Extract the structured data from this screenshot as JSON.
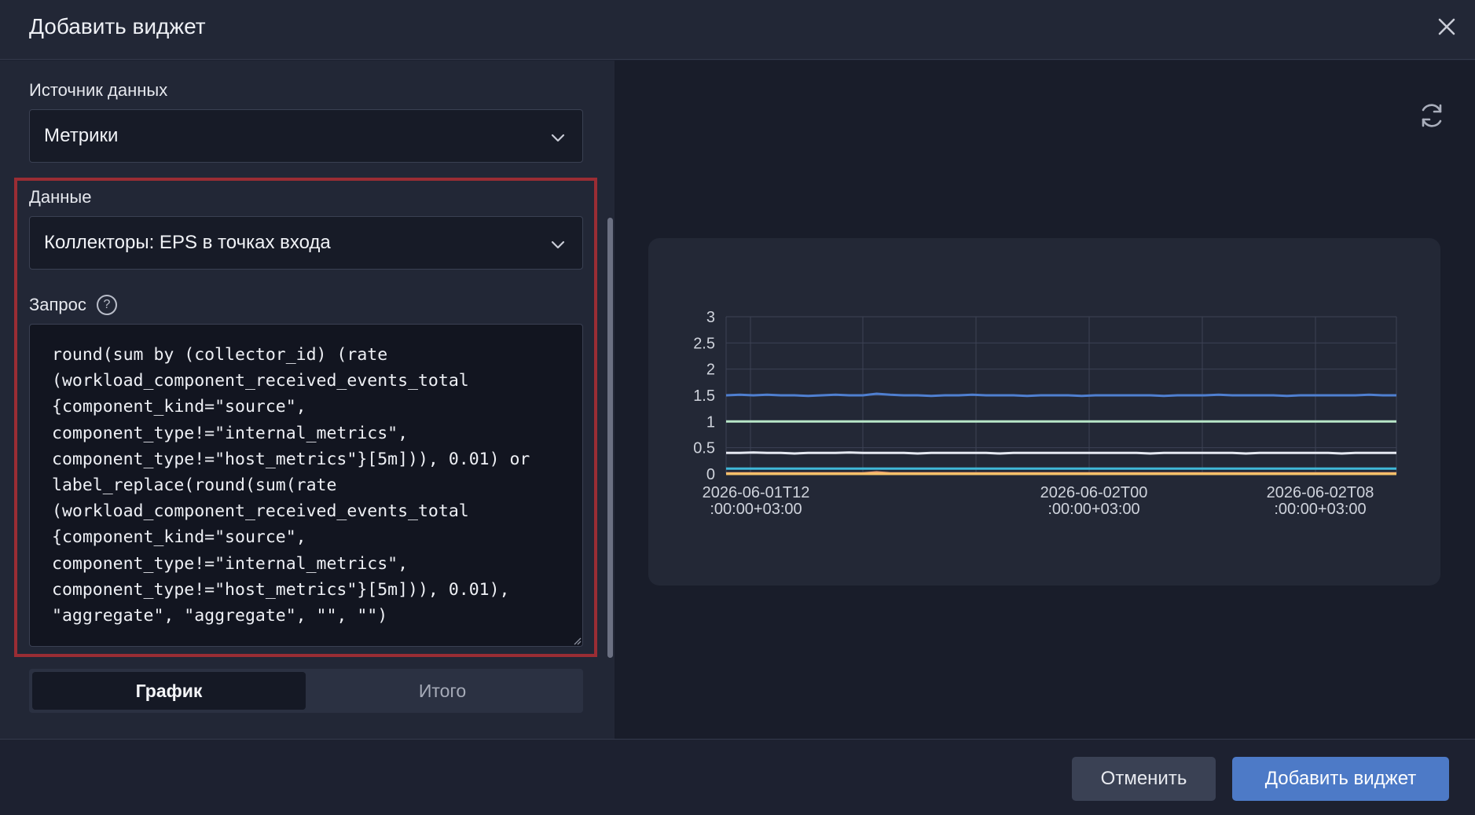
{
  "dialog": {
    "title": "Добавить виджет"
  },
  "form": {
    "source_label": "Источник данных",
    "source_value": "Метрики",
    "data_label": "Данные",
    "data_value": "Коллекторы: EPS в точках входа",
    "query_label": "Запрос",
    "query_help_icon": "?",
    "query_text": "round(sum by (collector_id) (rate\n(workload_component_received_events_total\n{component_kind=\"source\",\ncomponent_type!=\"internal_metrics\",\ncomponent_type!=\"host_metrics\"}[5m])), 0.01) or\nlabel_replace(round(sum(rate\n(workload_component_received_events_total\n{component_kind=\"source\",\ncomponent_type!=\"internal_metrics\",\ncomponent_type!=\"host_metrics\"}[5m])), 0.01),\n\"aggregate\", \"aggregate\", \"\", \"\")"
  },
  "tabs": [
    {
      "label": "График",
      "active": true
    },
    {
      "label": "Итого",
      "active": false
    }
  ],
  "footer": {
    "cancel_label": "Отменить",
    "add_label": "Добавить виджет"
  },
  "colors": {
    "highlight_border": "#9a2d34",
    "primary_button": "#4d7ac7"
  },
  "chart_data": {
    "type": "line",
    "ylim": [
      0,
      3
    ],
    "yticks": [
      "0",
      "0.5",
      "1",
      "1.5",
      "2",
      "2.5",
      "3"
    ],
    "xtick_labels": [
      {
        "line1": "2026-06-01T12",
        "line2": ":00:00+03:00"
      },
      {
        "line1": "2026-06-02T00",
        "line2": ":00:00+03:00"
      },
      {
        "line1": "2026-06-02T08",
        "line2": ":00:00+03:00"
      }
    ],
    "grid": true,
    "legend": "none",
    "series": [
      {
        "color": "#4f7fd0",
        "values": [
          1.5,
          1.51,
          1.5,
          1.51,
          1.5,
          1.5,
          1.49,
          1.5,
          1.51,
          1.5,
          1.5,
          1.53,
          1.51,
          1.5,
          1.5,
          1.49,
          1.5,
          1.5,
          1.51,
          1.5,
          1.5,
          1.5,
          1.49,
          1.5,
          1.5,
          1.5,
          1.49,
          1.5,
          1.5,
          1.5,
          1.5,
          1.5,
          1.49,
          1.5,
          1.5,
          1.5,
          1.51,
          1.5,
          1.5,
          1.5,
          1.5,
          1.49,
          1.5,
          1.5,
          1.5,
          1.5,
          1.5,
          1.51,
          1.5,
          1.5
        ]
      },
      {
        "color": "#b8e6c8",
        "values": [
          1,
          1,
          1,
          1,
          1,
          1,
          1,
          1,
          1,
          1,
          1,
          1,
          1,
          1,
          1,
          1,
          1,
          1,
          1,
          1,
          1,
          1,
          1,
          1,
          1,
          1,
          1,
          1,
          1,
          1,
          1,
          1,
          1,
          1,
          1,
          1,
          1,
          1,
          1,
          1,
          1,
          1,
          1,
          1,
          1,
          1,
          1,
          1,
          1,
          1
        ]
      },
      {
        "color": "#e6e9f2",
        "values": [
          0.4,
          0.4,
          0.41,
          0.4,
          0.4,
          0.39,
          0.4,
          0.4,
          0.4,
          0.41,
          0.4,
          0.4,
          0.4,
          0.4,
          0.39,
          0.4,
          0.4,
          0.4,
          0.4,
          0.4,
          0.39,
          0.4,
          0.4,
          0.4,
          0.4,
          0.4,
          0.4,
          0.4,
          0.4,
          0.4,
          0.4,
          0.39,
          0.4,
          0.4,
          0.4,
          0.4,
          0.4,
          0.4,
          0.39,
          0.4,
          0.4,
          0.4,
          0.4,
          0.4,
          0.4,
          0.39,
          0.4,
          0.4,
          0.4,
          0.4
        ]
      },
      {
        "color": "#3fb8d8",
        "values": [
          0.1,
          0.1,
          0.1,
          0.1,
          0.1,
          0.1,
          0.1,
          0.1,
          0.1,
          0.1,
          0.1,
          0.1,
          0.1,
          0.1,
          0.1,
          0.1,
          0.1,
          0.1,
          0.1,
          0.1,
          0.1,
          0.1,
          0.1,
          0.1,
          0.1,
          0.1,
          0.1,
          0.1,
          0.1,
          0.1,
          0.1,
          0.1,
          0.1,
          0.1,
          0.1,
          0.1,
          0.1,
          0.1,
          0.1,
          0.1,
          0.1,
          0.1,
          0.1,
          0.1,
          0.1,
          0.1,
          0.1,
          0.1,
          0.1,
          0.1
        ]
      },
      {
        "color": "#f0a070",
        "values": [
          0.01,
          0.01,
          0.01,
          0.01,
          0.01,
          0.01,
          0.01,
          0.01,
          0.01,
          0.01,
          0.01,
          0.03,
          0.01,
          0.01,
          0.01,
          0.01,
          0.01,
          0.01,
          0.01,
          0.01,
          0.01,
          0.01,
          0.01,
          0.01,
          0.01,
          0.01,
          0.01,
          0.01,
          0.01,
          0.01,
          0.01,
          0.01,
          0.01,
          0.01,
          0.01,
          0.01,
          0.01,
          0.01,
          0.01,
          0.01,
          0.01,
          0.01,
          0.01,
          0.01,
          0.01,
          0.01,
          0.01,
          0.01,
          0.01,
          0.01
        ]
      },
      {
        "color": "#f6c36a",
        "values": [
          0,
          0,
          0,
          0,
          0,
          0,
          0,
          0,
          0,
          0,
          0,
          0,
          0,
          0,
          0,
          0,
          0,
          0,
          0,
          0,
          0,
          0,
          0,
          0,
          0,
          0,
          0,
          0,
          0,
          0,
          0,
          0,
          0,
          0,
          0,
          0,
          0,
          0,
          0,
          0,
          0,
          0,
          0,
          0,
          0,
          0,
          0,
          0,
          0,
          0
        ]
      }
    ]
  }
}
